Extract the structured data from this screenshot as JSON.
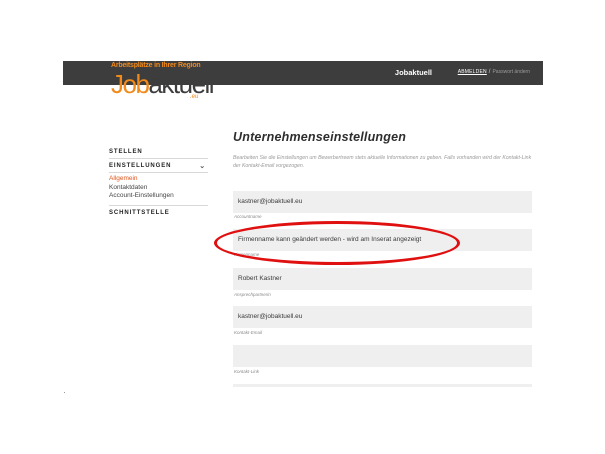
{
  "header": {
    "brand": "Jobaktuell",
    "login_link": "ABMELDEN",
    "separator": "/",
    "password_link": "Passwort ändern"
  },
  "logo": {
    "tagline": "Arbeitsplätze in Ihrer Region",
    "word_job": "Job",
    "word_aktuell": "aktuell",
    "suffix": ".eu"
  },
  "sidebar": {
    "stellen": "STELLEN",
    "einstellungen": "EINSTELLUNGEN",
    "chevron": "⌄",
    "items": [
      {
        "label": "Allgemein",
        "active": true
      },
      {
        "label": "Kontaktdaten",
        "active": false
      },
      {
        "label": "Account-Einstellungen",
        "active": false
      }
    ],
    "schnittstelle": "SCHNITTSTELLE"
  },
  "main": {
    "title": "Unternehmenseinstellungen",
    "intro": "Bearbeiten Sie die Einstellungen um Bewerbertreem stets aktuelle Informationen zu geben. Falls vorhanden wird der Kontakt-Link der Kontakt-Email vorgezogen.",
    "fields": [
      {
        "value": "kastner@jobaktuell.eu",
        "caption": "Accountname"
      },
      {
        "value": "Firmenname kann geändert werden - wird am Inserat angezeigt",
        "caption": "Firmenname"
      },
      {
        "value": "Robert Kastner",
        "caption": "Ansprechpartnerin"
      },
      {
        "value": "kastner@jobaktuell.eu",
        "caption": "Kontakt-Email"
      },
      {
        "value": "",
        "caption": "Kontakt-Link"
      }
    ]
  },
  "colors": {
    "accent_orange": "#f18a1a",
    "header_bg": "#3d3d3d",
    "highlight_red": "#e01010",
    "active_link": "#e0561c"
  }
}
